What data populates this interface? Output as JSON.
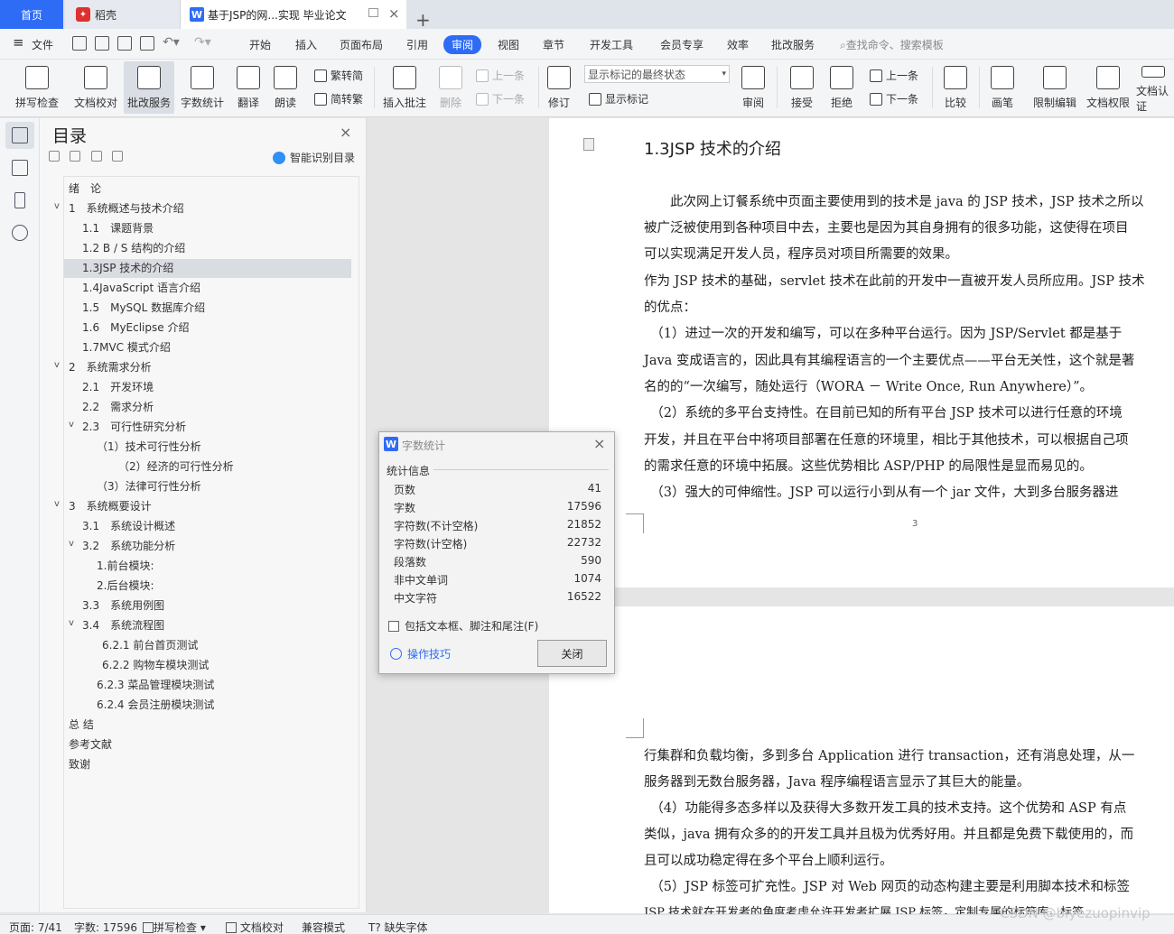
{
  "tabs": {
    "home": "首页",
    "daoke": "稻壳",
    "doc": "基于JSP的网...实现 毕业论文",
    "add": "+"
  },
  "menu": {
    "file": "文件",
    "items": [
      "开始",
      "插入",
      "页面布局",
      "引用",
      "审阅",
      "视图",
      "章节",
      "开发工具",
      "会员专享",
      "效率",
      "批改服务"
    ],
    "active": "审阅",
    "search": "查找命令、搜索模板"
  },
  "ribbon": {
    "spell": "拼写检查",
    "proof": "文档校对",
    "correct": "批改服务",
    "count": "字数统计",
    "translate": "翻译",
    "read": "朗读",
    "trad": "繁转简",
    "simp": "简转繁",
    "insert_comment": "插入批注",
    "delete": "删除",
    "prev1": "上一条",
    "next1": "下一条",
    "track": "修订",
    "markup_select": "显示标记的最终状态",
    "show_markup": "显示标记",
    "review": "审阅",
    "accept": "接受",
    "reject": "拒绝",
    "prev2": "上一条",
    "next2": "下一条",
    "compare": "比较",
    "pen": "画笔",
    "restrict": "限制编辑",
    "rights": "文档权限",
    "auth": "文档认证"
  },
  "toc": {
    "title": "目录",
    "smart": "智能识别目录",
    "items": [
      {
        "label": "绪　论"
      },
      {
        "label": "1　系统概述与技术介绍"
      },
      {
        "label": "1.1　课题背景"
      },
      {
        "label": "1.2 B / S 结构的介绍"
      },
      {
        "label": "1.3JSP 技术的介绍"
      },
      {
        "label": "1.4JavaScript 语言介绍"
      },
      {
        "label": "1.5　MySQL 数据库介绍"
      },
      {
        "label": "1.6　MyEclipse 介绍"
      },
      {
        "label": "1.7MVC 模式介绍"
      },
      {
        "label": "2　系统需求分析"
      },
      {
        "label": "2.1　开发环境"
      },
      {
        "label": "2.2　需求分析"
      },
      {
        "label": "2.3　可行性研究分析"
      },
      {
        "label": "（1）技术可行性分析"
      },
      {
        "label": "（2）经济的可行性分析"
      },
      {
        "label": "（3）法律可行性分析"
      },
      {
        "label": "3　系统概要设计"
      },
      {
        "label": "3.1　系统设计概述"
      },
      {
        "label": "3.2　系统功能分析"
      },
      {
        "label": "1.前台模块:"
      },
      {
        "label": "2.后台模块:"
      },
      {
        "label": "3.3　系统用例图"
      },
      {
        "label": "3.4　系统流程图"
      },
      {
        "label": "6.2.1 前台首页测试"
      },
      {
        "label": "6.2.2 购物车模块测试"
      },
      {
        "label": "6.2.3 菜品管理模块测试"
      },
      {
        "label": "6.2.4 会员注册模块测试"
      },
      {
        "label": "总 结"
      },
      {
        "label": "参考文献"
      },
      {
        "label": "致谢"
      }
    ]
  },
  "doc": {
    "heading": "1.3JSP 技术的介绍",
    "page_number": "3",
    "page1_lines": [
      "　　此次网上订餐系统中页面主要使用到的技术是 java 的 JSP 技术，JSP 技术之所以",
      "被广泛被使用到各种项目中去，主要也是因为其自身拥有的很多功能，这使得在项目",
      "可以实现满足开发人员，程序员对项目所需要的效果。",
      "作为 JSP 技术的基础，servlet 技术在此前的开发中一直被开发人员所应用。JSP 技术",
      "的优点：",
      "　（1）进过一次的开发和编写，可以在多种平台运行。因为 JSP/Servlet 都是基于",
      "Java 变成语言的，因此具有其编程语言的一个主要优点——平台无关性，这个就是著",
      "名的的“一次编写，随处运行（WORA － Write Once, Run Anywhere）”。",
      "　（2）系统的多平台支持性。在目前已知的所有平台 JSP 技术可以进行任意的环境",
      "开发，并且在平台中将项目部署在任意的环境里，相比于其他技术，可以根据自己项",
      "的需求任意的环境中拓展。这些优势相比 ASP/PHP 的局限性是显而易见的。",
      "　（3）强大的可伸缩性。JSP 可以运行小到从有一个 jar 文件，大到多台服务器进"
    ],
    "page2_lines": [
      "行集群和负载均衡，多到多台 Application 进行 transaction，还有消息处理，从一",
      "服务器到无数台服务器，Java 程序编程语言显示了其巨大的能量。",
      "　（4）功能得多态多样以及获得大多数开发工具的技术支持。这个优势和 ASP 有点",
      "类似，java 拥有众多的的开发工具并且极为优秀好用。并且都是免费下载使用的，而",
      "且可以成功稳定得在多个平台上顺利运行。",
      "　（5）JSP 标签可扩充性。JSP 对 Web 网页的动态构建主要是利用脚本技术和标签",
      "JSP 技术就在开发者的角度考虑允许开发者扩展 JSP 标签，定制专属的标签库，标签"
    ]
  },
  "dialog": {
    "title": "字数统计",
    "section": "统计信息",
    "rows": [
      {
        "label": "页数",
        "value": "41"
      },
      {
        "label": "字数",
        "value": "17596"
      },
      {
        "label": "字符数(不计空格)",
        "value": "21852"
      },
      {
        "label": "字符数(计空格)",
        "value": "22732"
      },
      {
        "label": "段落数",
        "value": "590"
      },
      {
        "label": "非中文单词",
        "value": "1074"
      },
      {
        "label": "中文字符",
        "value": "16522"
      }
    ],
    "checkbox": "包括文本框、脚注和尾注(F)",
    "tips": "操作技巧",
    "close": "关闭"
  },
  "status": {
    "page": "页面: 7/41",
    "words": "字数: 17596",
    "spell": "拼写检查",
    "proof": "文档校对",
    "compat": "兼容模式",
    "missing_font": "缺失字体"
  },
  "watermark": "CSDN @biyezuopinvip",
  "colors": {
    "accent": "#2f6cf5"
  }
}
